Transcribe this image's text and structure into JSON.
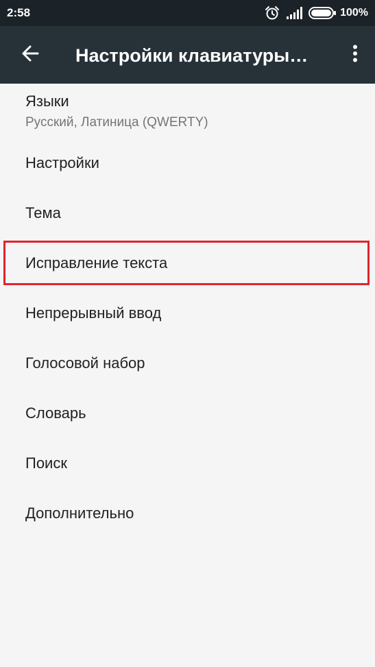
{
  "status_bar": {
    "time": "2:58",
    "battery_percent": "100%",
    "icons": [
      "alarm-icon",
      "signal-icon",
      "battery-icon"
    ]
  },
  "toolbar": {
    "back_icon": "arrow-back-icon",
    "title": "Настройки клавиатуры…",
    "overflow_icon": "more-vert-icon"
  },
  "settings": {
    "items": [
      {
        "title": "Языки",
        "summary": "Русский, Латиница (QWERTY)"
      },
      {
        "title": "Настройки"
      },
      {
        "title": "Тема"
      },
      {
        "title": "Исправление текста"
      },
      {
        "title": "Непрерывный ввод"
      },
      {
        "title": "Голосовой набор"
      },
      {
        "title": "Словарь"
      },
      {
        "title": "Поиск"
      },
      {
        "title": "Дополнительно"
      }
    ]
  },
  "colors": {
    "status_bar": "#1c2328",
    "toolbar": "#263238",
    "background": "#f5f5f5",
    "highlight": "#e0232b"
  }
}
